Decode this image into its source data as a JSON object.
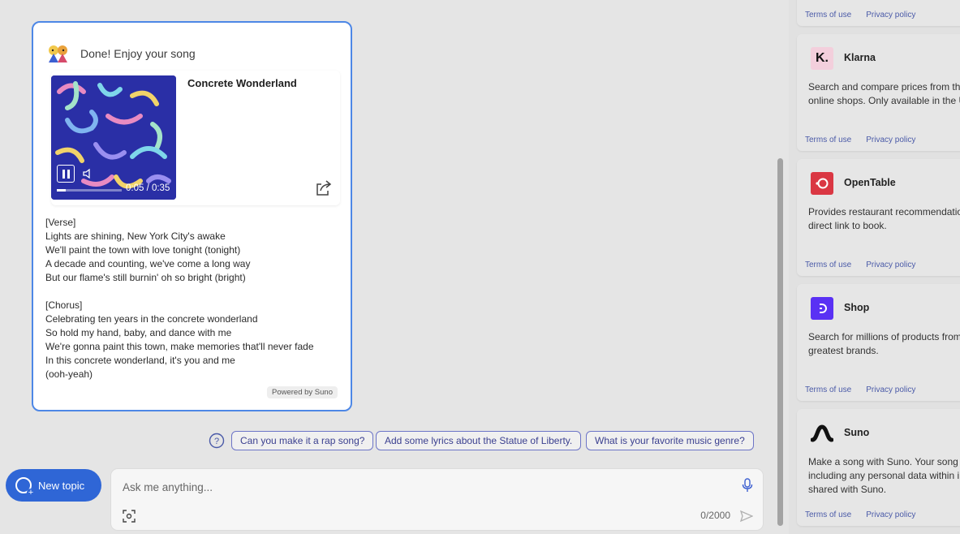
{
  "chat": {
    "header": "Done! Enjoy your song",
    "song": {
      "title": "Concrete Wonderland",
      "time": "0:05 / 0:35",
      "progress": 0.14
    },
    "lyrics": [
      "[Verse]",
      "Lights are shining, New York City's awake",
      "We'll paint the town with love tonight (tonight)",
      "A decade and counting, we've come a long way",
      "But our flame's still burnin' oh so bright (bright)",
      "",
      "[Chorus]",
      "Celebrating ten years in the concrete wonderland",
      "So hold my hand, baby, and dance with me",
      "We're gonna paint this town, make memories that'll never fade",
      "In this concrete wonderland, it's you and me",
      "(ooh-yeah)"
    ],
    "powered_by": "Powered by Suno"
  },
  "suggestions": [
    "Can you make it a rap song?",
    "Add some lyrics about the Statue of Liberty.",
    "What is your favorite music genre?"
  ],
  "new_topic": "New topic",
  "input": {
    "placeholder": "Ask me anything...",
    "counter": "0/2000"
  },
  "plugins": [
    {
      "name": "",
      "desc": [],
      "terms": "Terms of use",
      "privacy": "Privacy policy"
    },
    {
      "name": "Klarna",
      "desc": [
        "Search and compare prices from th",
        "online shops. Only available in the U"
      ],
      "terms": "Terms of use",
      "privacy": "Privacy policy",
      "logo_text": "K."
    },
    {
      "name": "OpenTable",
      "desc": [
        "Provides restaurant recommendatio",
        "direct link to book."
      ],
      "terms": "Terms of use",
      "privacy": "Privacy policy"
    },
    {
      "name": "Shop",
      "desc": [
        "Search for millions of products from",
        "greatest brands."
      ],
      "terms": "Terms of use",
      "privacy": "Privacy policy"
    },
    {
      "name": "Suno",
      "desc": [
        "Make a song with Suno. Your song i",
        "including any personal data within i",
        "shared with Suno."
      ],
      "terms": "Terms of use",
      "privacy": "Privacy policy"
    }
  ],
  "colors": {
    "accent": "#2f66d6",
    "klarna_bg": "#f3cfdc",
    "opentable": "#da3743",
    "shop": "#5a31f4"
  }
}
